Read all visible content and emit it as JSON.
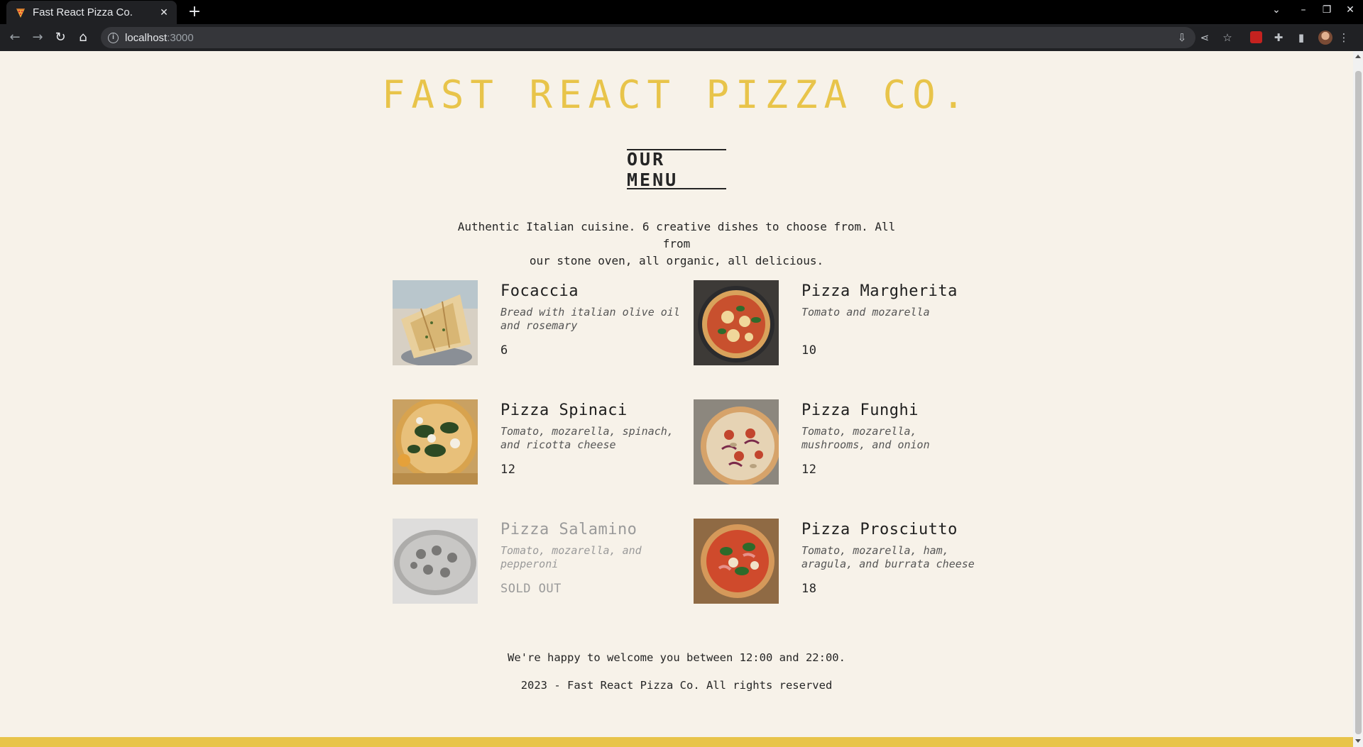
{
  "browser": {
    "tab_title": "Fast React Pizza Co.",
    "tab_close": "✕",
    "new_tab": "+",
    "url_host": "localhost",
    "url_port": ":3000"
  },
  "page": {
    "brand": "FAST REACT PIZZA CO.",
    "heading": "OUR MENU",
    "intro_line1": "Authentic Italian cuisine. 6 creative dishes to choose from. All from",
    "intro_line2": "our stone oven, all organic, all delicious.",
    "items": [
      {
        "name": "Focaccia",
        "ingredients": "Bread with italian olive oil and rosemary",
        "price": "6",
        "sold_out": false
      },
      {
        "name": "Pizza Margherita",
        "ingredients": "Tomato and mozarella",
        "price": "10",
        "sold_out": false
      },
      {
        "name": "Pizza Spinaci",
        "ingredients": "Tomato, mozarella, spinach, and ricotta cheese",
        "price": "12",
        "sold_out": false
      },
      {
        "name": "Pizza Funghi",
        "ingredients": "Tomato, mozarella, mushrooms, and onion",
        "price": "12",
        "sold_out": false
      },
      {
        "name": "Pizza Salamino",
        "ingredients": "Tomato, mozarella, and pepperoni",
        "price": "SOLD OUT",
        "sold_out": true
      },
      {
        "name": "Pizza Prosciutto",
        "ingredients": "Tomato, mozarella, ham, aragula, and burrata cheese",
        "price": "18",
        "sold_out": false
      }
    ],
    "footer_hours": "We're happy to welcome you between 12:00 and 22:00.",
    "footer_copy": "2023 - Fast React Pizza Co. All rights reserved"
  },
  "colors": {
    "background": "#f7f2e9",
    "brand_yellow": "#e8c44a",
    "text": "#252525",
    "sold_out": "#9a9a9a"
  }
}
